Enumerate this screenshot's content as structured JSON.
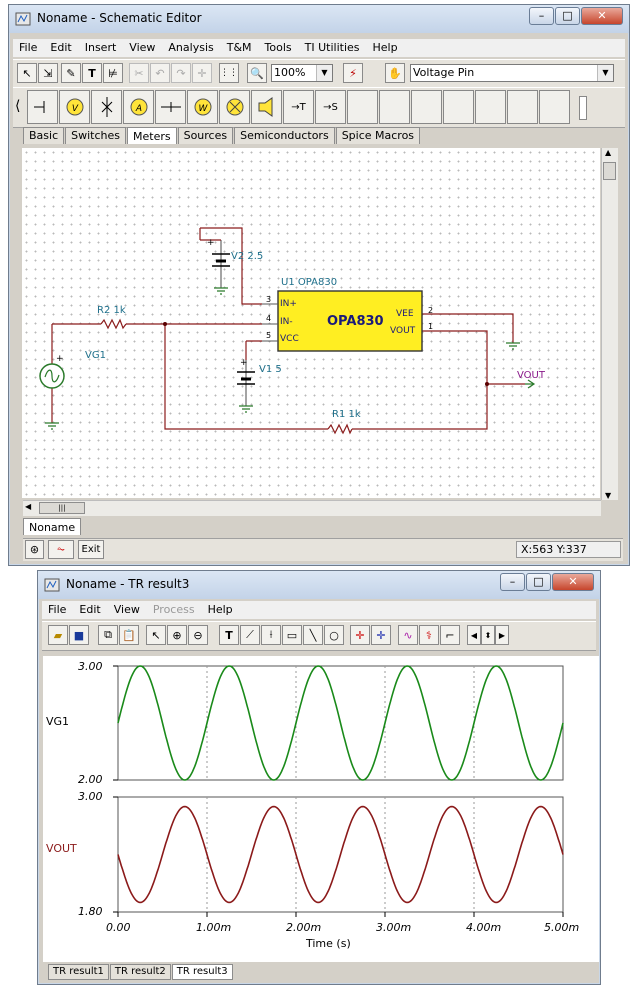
{
  "schematic": {
    "title": "Noname - Schematic Editor",
    "menu": [
      "File",
      "Edit",
      "Insert",
      "View",
      "Analysis",
      "T&M",
      "Tools",
      "TI Utilities",
      "Help"
    ],
    "zoom": "100%",
    "component_select": "Voltage Pin",
    "component_tabs": [
      "Basic",
      "Switches",
      "Meters",
      "Sources",
      "Semiconductors",
      "Spice Macros"
    ],
    "active_tab": "Meters",
    "sheet_tab": "Noname",
    "status": {
      "exit_label": "Exit",
      "coords": "X:563 Y:337"
    },
    "circuit": {
      "u1_label": "U1 OPA830",
      "u1_part": "OPA830",
      "pins": [
        "IN+",
        "IN-",
        "VCC",
        "VEE",
        "VOUT"
      ],
      "pin_numbers": [
        "3",
        "4",
        "5",
        "2",
        "1"
      ],
      "v2_label": "V2 2.5",
      "v1_label": "V1 5",
      "r2_label": "R2 1k",
      "r1_label": "R1 1k",
      "vg1_label": "VG1",
      "vout_label": "VOUT",
      "plus": "+"
    }
  },
  "result": {
    "title": "Noname - TR result3",
    "menu": [
      "File",
      "Edit",
      "View",
      "Process",
      "Help"
    ],
    "menu_disabled": [
      "Process"
    ],
    "tabs": [
      "TR result1",
      "TR result2",
      "TR result3"
    ],
    "active_tab": "TR result3"
  },
  "chart_data": [
    {
      "type": "line",
      "series": [
        {
          "name": "VG1",
          "x_ms": [
            0,
            0.25,
            0.5,
            0.75,
            1,
            1.25,
            1.5,
            1.75,
            2,
            2.25,
            2.5,
            2.75,
            3,
            3.25,
            3.5,
            3.75,
            4,
            4.25,
            4.5,
            4.75,
            5
          ],
          "y": [
            2.5,
            3,
            2.5,
            2,
            2.5,
            3,
            2.5,
            2,
            2.5,
            3,
            2.5,
            2,
            2.5,
            3,
            2.5,
            2,
            2.5,
            3,
            2.5,
            2,
            2.5
          ]
        }
      ],
      "xlim_ms": [
        0,
        5
      ],
      "ylim": [
        2,
        3
      ],
      "ytick_labels": [
        "3.00",
        "2.00"
      ],
      "color": "#1a8a1a",
      "grid": "vertical dashed"
    },
    {
      "type": "line",
      "series": [
        {
          "name": "VOUT",
          "x_ms": [
            0,
            0.25,
            0.5,
            0.75,
            1,
            1.25,
            1.5,
            1.75,
            2,
            2.25,
            2.5,
            2.75,
            3,
            3.25,
            3.5,
            3.75,
            4,
            4.25,
            4.5,
            4.75,
            5
          ],
          "y": [
            2.4,
            1.9,
            2.4,
            2.9,
            2.4,
            1.9,
            2.4,
            2.9,
            2.4,
            1.9,
            2.4,
            2.9,
            2.4,
            1.9,
            2.4,
            2.9,
            2.4,
            1.9,
            2.4,
            2.9,
            2.4
          ]
        }
      ],
      "xlim_ms": [
        0,
        5
      ],
      "ylim": [
        1.8,
        3
      ],
      "ytick_labels": [
        "3.00",
        "1.80"
      ],
      "color": "#8b1a1a",
      "xtick_labels": [
        "0.00",
        "1.00m",
        "2.00m",
        "3.00m",
        "4.00m",
        "5.00m"
      ],
      "xlabel": "Time (s)",
      "grid": "vertical dashed"
    }
  ]
}
